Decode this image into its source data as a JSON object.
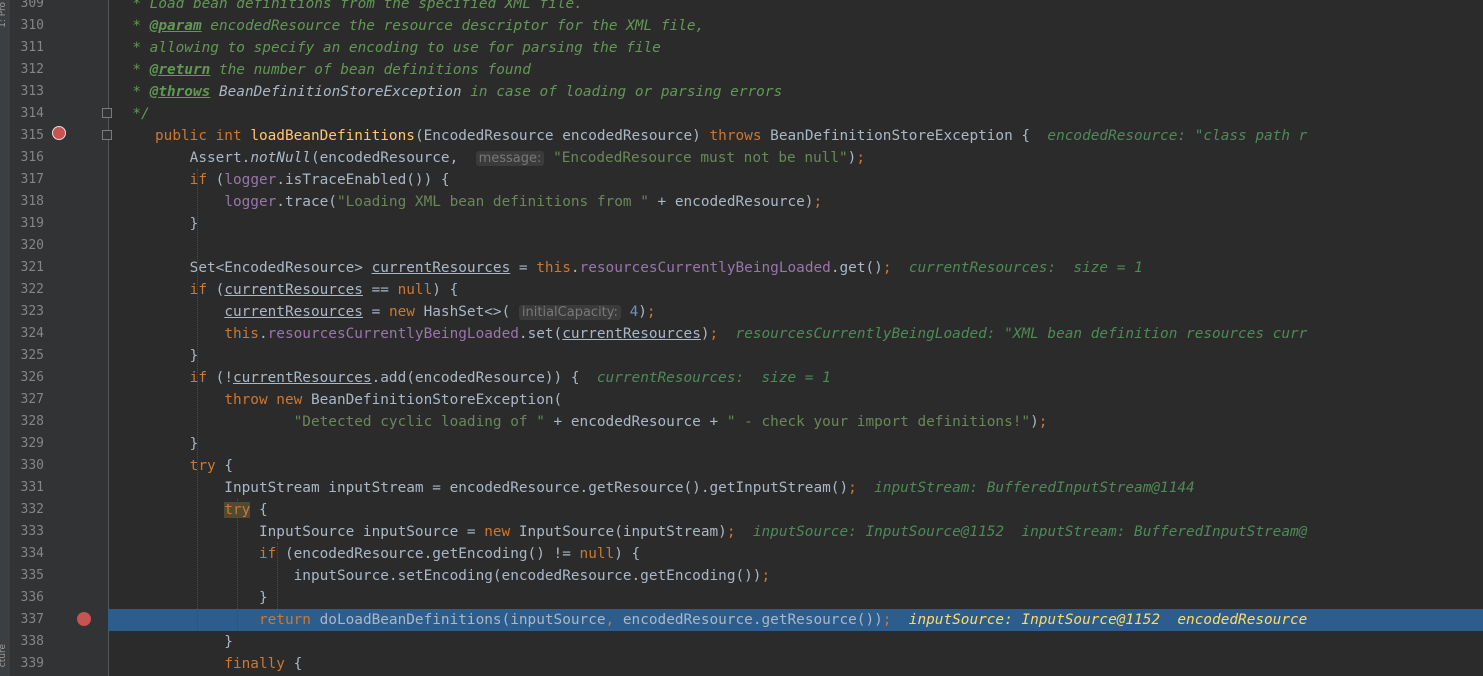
{
  "sidebar": {
    "top_label": "1: Pro",
    "bottom_label": "cture"
  },
  "lines": [
    {
      "n": "309",
      "t": "  * Load bean definitions from the specified XML file."
    },
    {
      "n": "310",
      "t": "  * @param encodedResource the resource descriptor for the XML file,"
    },
    {
      "n": "311",
      "t": "  * allowing to specify an encoding to use for parsing the file"
    },
    {
      "n": "312",
      "t": "  * @return the number of bean definitions found"
    },
    {
      "n": "313",
      "t": "  * @throws BeanDefinitionStoreException in case of loading or parsing errors"
    },
    {
      "n": "314",
      "t": "  */"
    },
    {
      "n": "315",
      "t": "public int loadBeanDefinitions(EncodedResource encodedResource) throws BeanDefinitionStoreException {  encodedResource: \"class path r"
    },
    {
      "n": "316",
      "t": "    Assert.notNull(encodedResource,  message: \"EncodedResource must not be null\");"
    },
    {
      "n": "317",
      "t": "    if (logger.isTraceEnabled()) {"
    },
    {
      "n": "318",
      "t": "        logger.trace(\"Loading XML bean definitions from \" + encodedResource);"
    },
    {
      "n": "319",
      "t": "    }"
    },
    {
      "n": "320",
      "t": ""
    },
    {
      "n": "321",
      "t": "    Set<EncodedResource> currentResources = this.resourcesCurrentlyBeingLoaded.get();  currentResources:  size = 1"
    },
    {
      "n": "322",
      "t": "    if (currentResources == null) {"
    },
    {
      "n": "323",
      "t": "        currentResources = new HashSet<>( initialCapacity: 4);"
    },
    {
      "n": "324",
      "t": "        this.resourcesCurrentlyBeingLoaded.set(currentResources);  resourcesCurrentlyBeingLoaded: \"XML bean definition resources curr"
    },
    {
      "n": "325",
      "t": "    }"
    },
    {
      "n": "326",
      "t": "    if (!currentResources.add(encodedResource)) {  currentResources:  size = 1"
    },
    {
      "n": "327",
      "t": "        throw new BeanDefinitionStoreException("
    },
    {
      "n": "328",
      "t": "                \"Detected cyclic loading of \" + encodedResource + \" - check your import definitions!\");"
    },
    {
      "n": "329",
      "t": "    }"
    },
    {
      "n": "330",
      "t": "    try {"
    },
    {
      "n": "331",
      "t": "        InputStream inputStream = encodedResource.getResource().getInputStream();  inputStream: BufferedInputStream@1144"
    },
    {
      "n": "332",
      "t": "        try {"
    },
    {
      "n": "333",
      "t": "            InputSource inputSource = new InputSource(inputStream);  inputSource: InputSource@1152  inputStream: BufferedInputStream@"
    },
    {
      "n": "334",
      "t": "            if (encodedResource.getEncoding() != null) {"
    },
    {
      "n": "335",
      "t": "                inputSource.setEncoding(encodedResource.getEncoding());"
    },
    {
      "n": "336",
      "t": "            }"
    },
    {
      "n": "337",
      "t": "            return doLoadBeanDefinitions(inputSource, encodedResource.getResource());  inputSource: InputSource@1152  encodedResource"
    },
    {
      "n": "338",
      "t": "        }"
    },
    {
      "n": "339",
      "t": "        finally {"
    }
  ],
  "highlight_line": "337",
  "colors": {
    "background": "#2b2b2b",
    "keyword": "#cc7832",
    "comment": "#629755",
    "string": "#6a8759",
    "field": "#9876aa",
    "highlight": "#2d5d8c"
  }
}
